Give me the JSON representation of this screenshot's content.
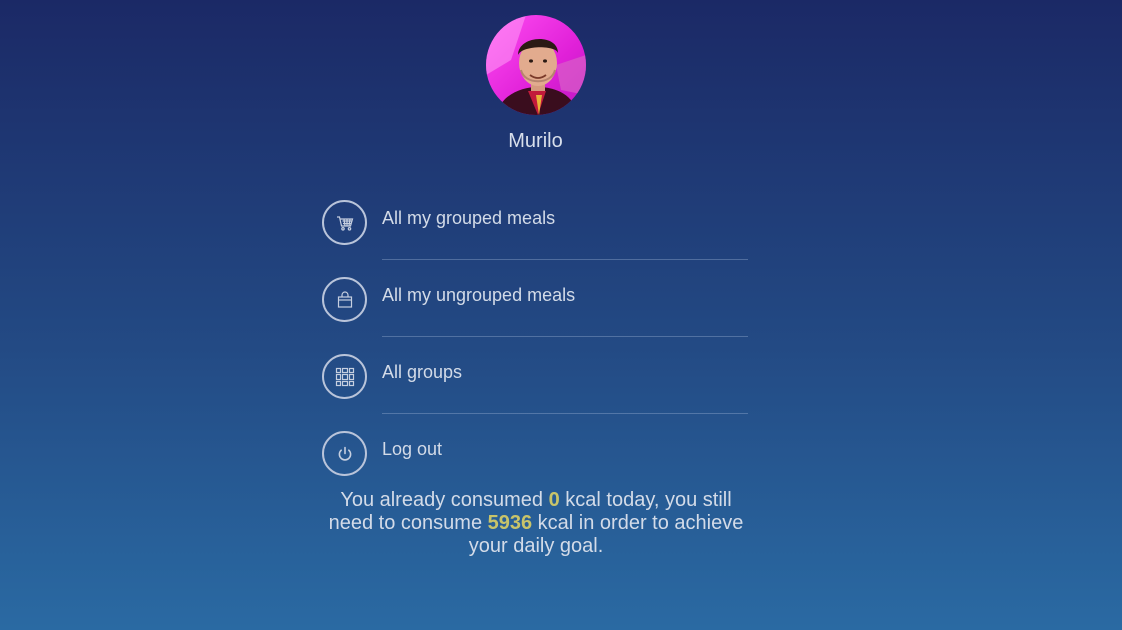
{
  "profile": {
    "name": "Murilo"
  },
  "menu": {
    "items": [
      {
        "label": "All my grouped meals",
        "icon": "shopping-cart-icon"
      },
      {
        "label": "All my ungrouped meals",
        "icon": "shopping-bag-icon"
      },
      {
        "label": "All groups",
        "icon": "grid-icon"
      },
      {
        "label": "Log out",
        "icon": "power-icon"
      }
    ]
  },
  "summary": {
    "part1": "You already consumed ",
    "consumed": "0",
    "part2": " kcal today, you still need to consume ",
    "remaining": "5936",
    "part3": " kcal in order to achieve your daily goal."
  },
  "colors": {
    "background_top": "#1b2966",
    "background_bottom": "#2a6aa3",
    "highlight": "#c8c46a",
    "text": "#d3dbe8"
  }
}
